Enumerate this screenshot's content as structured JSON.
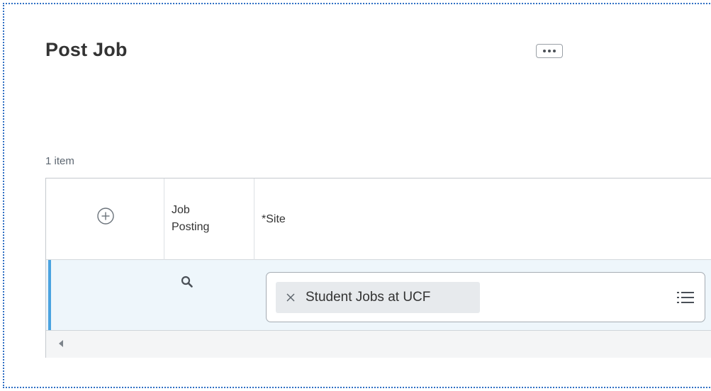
{
  "page": {
    "title": "Post Job",
    "more_actions": "more-actions"
  },
  "grid": {
    "count_label": "1 item",
    "columns": [
      {
        "label": "",
        "icon": "add-row-icon"
      },
      {
        "label": "Job Posting"
      },
      {
        "label": "*Site"
      }
    ],
    "rows": [
      {
        "job_posting_icon": "search-icon",
        "site": {
          "selected": [
            "Student Jobs at UCF"
          ],
          "remove_icon": "close-icon",
          "prompt_icon": "list-icon"
        }
      }
    ]
  },
  "colors": {
    "accent": "#4aa3e0",
    "row_selected": "#eef6fb",
    "frame_border": "#2f6fc4"
  }
}
